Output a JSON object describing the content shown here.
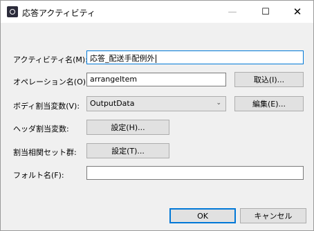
{
  "window": {
    "title": "応答アクティビティ",
    "min_symbol": "—",
    "max_symbol": "☐",
    "close_symbol": "✕"
  },
  "form": {
    "activity_name_label": "アクティビティ名(M):",
    "activity_name_value": "応答_配送手配例外",
    "operation_name_label": "オペレーション名(O):",
    "operation_name_value": "arrangeItem",
    "import_button": "取込(I)...",
    "body_var_label": "ボディ割当変数(V):",
    "body_var_value": "OutputData",
    "edit_button": "編集(E)...",
    "header_var_label": "ヘッダ割当変数:",
    "header_set_button": "設定(H)...",
    "correlation_label": "割当相関セット群:",
    "correlation_set_button": "設定(T)...",
    "fault_name_label": "フォルト名(F):",
    "fault_name_value": ""
  },
  "footer": {
    "ok_label": "OK",
    "cancel_label": "キャンセル"
  }
}
